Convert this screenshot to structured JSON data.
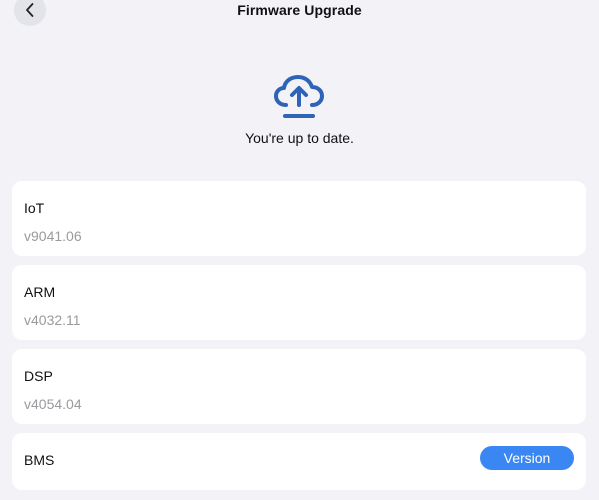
{
  "header": {
    "title": "Firmware Upgrade",
    "back_icon": "chevron-left-icon"
  },
  "status": {
    "icon": "cloud-upload-icon",
    "message": "You're up to date.",
    "icon_color": "#2f63b8"
  },
  "firmware": [
    {
      "name": "IoT",
      "version": "v9041.06"
    },
    {
      "name": "ARM",
      "version": "v4032.11"
    },
    {
      "name": "DSP",
      "version": "v4054.04"
    }
  ],
  "bms": {
    "name": "BMS",
    "button_label": "Version"
  },
  "colors": {
    "background": "#f2f2f7",
    "card": "#ffffff",
    "accent": "#3a87f4",
    "secondary_text": "#9a9a9f"
  }
}
